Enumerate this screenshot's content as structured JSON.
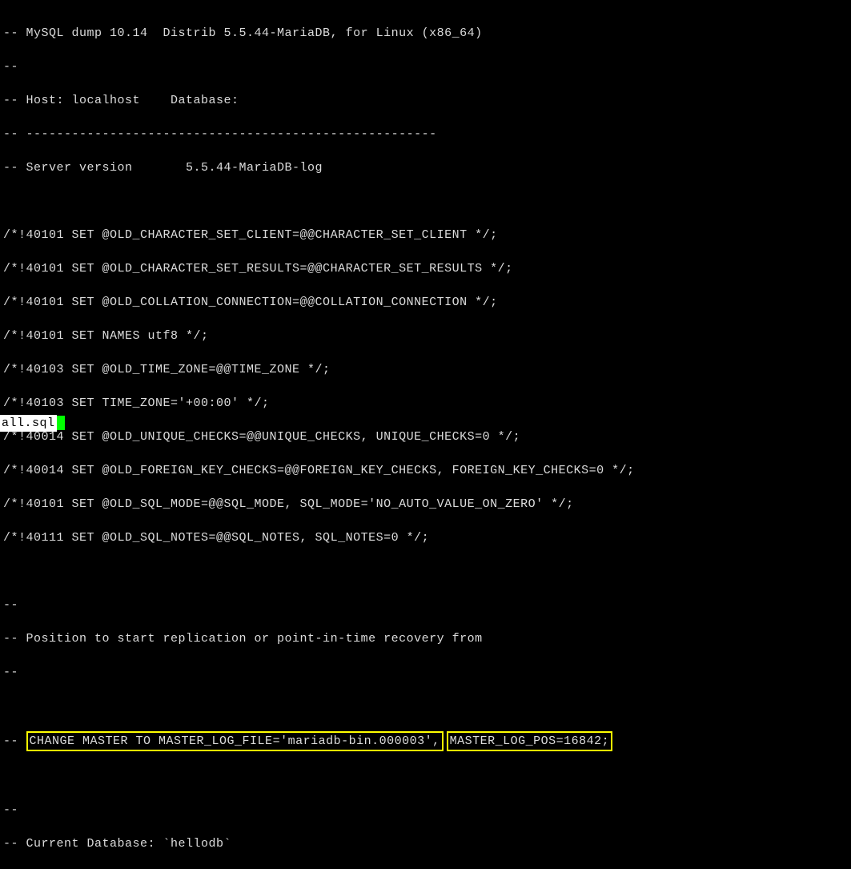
{
  "lines": {
    "l1": "-- MySQL dump 10.14  Distrib 5.5.44-MariaDB, for Linux (x86_64)",
    "l2": "--",
    "l3": "-- Host: localhost    Database: ",
    "l4": "-- ------------------------------------------------------",
    "l5": "-- Server version       5.5.44-MariaDB-log",
    "l6": "",
    "l7": "/*!40101 SET @OLD_CHARACTER_SET_CLIENT=@@CHARACTER_SET_CLIENT */;",
    "l8": "/*!40101 SET @OLD_CHARACTER_SET_RESULTS=@@CHARACTER_SET_RESULTS */;",
    "l9": "/*!40101 SET @OLD_COLLATION_CONNECTION=@@COLLATION_CONNECTION */;",
    "l10": "/*!40101 SET NAMES utf8 */;",
    "l11": "/*!40103 SET @OLD_TIME_ZONE=@@TIME_ZONE */;",
    "l12": "/*!40103 SET TIME_ZONE='+00:00' */;",
    "l13": "/*!40014 SET @OLD_UNIQUE_CHECKS=@@UNIQUE_CHECKS, UNIQUE_CHECKS=0 */;",
    "l14": "/*!40014 SET @OLD_FOREIGN_KEY_CHECKS=@@FOREIGN_KEY_CHECKS, FOREIGN_KEY_CHECKS=0 */;",
    "l15": "/*!40101 SET @OLD_SQL_MODE=@@SQL_MODE, SQL_MODE='NO_AUTO_VALUE_ON_ZERO' */;",
    "l16": "/*!40111 SET @OLD_SQL_NOTES=@@SQL_NOTES, SQL_NOTES=0 */;",
    "l17": "",
    "l18": "--",
    "l19": "-- Position to start replication or point-in-time recovery from",
    "l20": "--",
    "l21": "",
    "l22_prefix": "-- ",
    "l22_box1": "CHANGE MASTER TO MASTER_LOG_FILE='mariadb-bin.000003',",
    "l22_box2": "MASTER_LOG_POS=16842;",
    "l23": "",
    "l24": "--",
    "l25": "-- Current Database: `hellodb`",
    "status": "all.sql"
  }
}
